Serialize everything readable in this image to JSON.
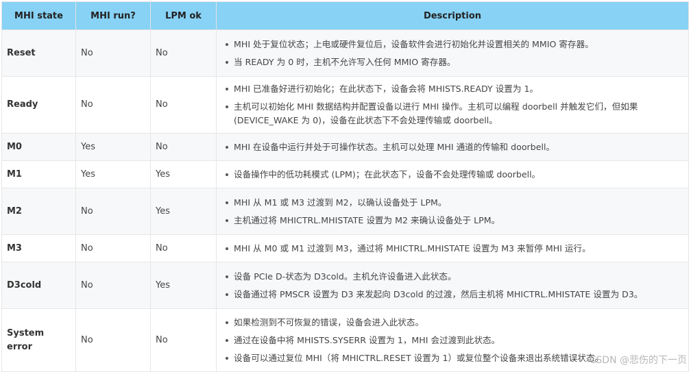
{
  "headers": [
    "MHI state",
    "MHI run?",
    "LPM ok",
    "Description"
  ],
  "rows": [
    {
      "state": "Reset",
      "run": "No",
      "lpm": "No",
      "desc": [
        "MHI 处于复位状态；上电或硬件复位后，设备软件会进行初始化并设置相关的 MMIO 寄存器。",
        "当 READY 为 0 时，主机不允许写入任何 MMIO 寄存器。"
      ]
    },
    {
      "state": "Ready",
      "run": "No",
      "lpm": "No",
      "desc": [
        "MHI 已准备好进行初始化；在此状态下，设备会将 MHISTS.READY 设置为 1。",
        "主机可以初始化 MHI 数据结构并配置设备以进行 MHI 操作。主机可以编程 doorbell 并触发它们，但如果 (DEVICE_WAKE 为 0)，设备在此状态下不会处理传输或 doorbell。"
      ]
    },
    {
      "state": "M0",
      "run": "Yes",
      "lpm": "No",
      "desc": [
        "MHI 在设备中运行并处于可操作状态。主机可以处理 MHI 通道的传输和 doorbell。"
      ]
    },
    {
      "state": "M1",
      "run": "Yes",
      "lpm": "Yes",
      "desc": [
        "设备操作中的低功耗模式 (LPM)；在此状态下，设备不会处理传输或 doorbell。"
      ]
    },
    {
      "state": "M2",
      "run": "No",
      "lpm": "Yes",
      "desc": [
        "MHI 从 M1 或 M3 过渡到 M2，以确认设备处于 LPM。",
        "主机通过将 MHICTRL.MHISTATE 设置为 M2 来确认设备处于 LPM。"
      ]
    },
    {
      "state": "M3",
      "run": "No",
      "lpm": "No",
      "desc": [
        "MHI 从 M0 或 M1 过渡到 M3，通过将 MHICTRL.MHISTATE 设置为 M3 来暂停 MHI 运行。"
      ]
    },
    {
      "state": "D3cold",
      "run": "No",
      "lpm": "Yes",
      "desc": [
        "设备 PCIe D-状态为 D3cold。主机允许设备进入此状态。",
        "设备通过将 PMSCR 设置为 D3 来发起向 D3cold 的过渡，然后主机将 MHICTRL.MHISTATE 设置为 D3。"
      ]
    },
    {
      "state": "System error",
      "run": "No",
      "lpm": "No",
      "desc": [
        "如果检测到不可恢复的错误，设备会进入此状态。",
        "通过在设备中将 MHISTS.SYSERR 设置为 1，MHI 会过渡到此状态。",
        "设备可以通过复位 MHI（将 MHICTRL.RESET 设置为 1）或复位整个设备来退出系统错误状态。"
      ]
    }
  ],
  "watermark": "CSDN @悲伤的下一页"
}
